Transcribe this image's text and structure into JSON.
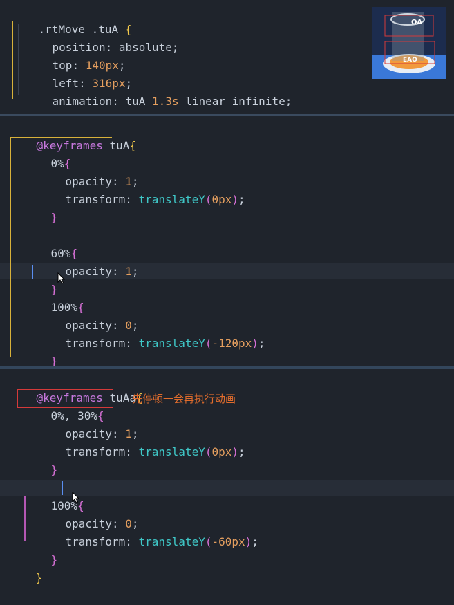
{
  "block1": {
    "selector_a": ".rtMove",
    "selector_b": ".tuA",
    "open": "{",
    "close": "}",
    "lines": [
      {
        "prop": "position",
        "value": "absolute"
      },
      {
        "prop": "top",
        "value": "140px"
      },
      {
        "prop": "left",
        "value": "316px"
      },
      {
        "prop": "animation",
        "name": "tuA",
        "duration": "1.3s",
        "rest": "linear infinite"
      }
    ]
  },
  "block2": {
    "keyword": "@keyframes",
    "name": "tuA",
    "steps": [
      {
        "pct": "0%",
        "opacity": "1",
        "translate": "0px"
      },
      {
        "pct": "60%",
        "opacity": "1"
      },
      {
        "pct": "100%",
        "opacity": "0",
        "translate": "-120px"
      }
    ]
  },
  "block3": {
    "keyword": "@keyframes",
    "name": "tuAa",
    "steps": [
      {
        "pct": "0%, 30%",
        "opacity": "1",
        "translate": "0px"
      },
      {
        "pct": "100%",
        "opacity": "0",
        "translate": "-60px"
      }
    ],
    "annotation": "先停顿一会再执行动画"
  },
  "tokens": {
    "opacity": "opacity",
    "transform": "transform",
    "translateY": "translateY",
    "colon": ": ",
    "semi": ";",
    "lparen": "(",
    "rparen": ")",
    "open": "{",
    "close": "}"
  },
  "colors": {
    "background": "#1f242c",
    "number": "#e59f5f",
    "function": "#3fc7c7",
    "keyword": "#c678dd",
    "brace_outer": "#f2c94c",
    "brace_inner": "#d670d6",
    "annotation": "#e06c2c",
    "highlight_box": "#d43a3a"
  },
  "thumbnail": {
    "labels": [
      "OA",
      "EAO"
    ]
  }
}
